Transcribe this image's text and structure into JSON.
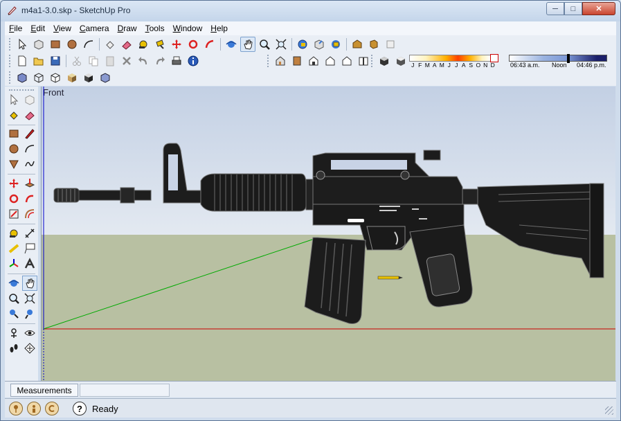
{
  "window": {
    "title": "m4a1-3.0.skp - SketchUp Pro",
    "buttons": {
      "minimize": "─",
      "maximize": "□",
      "close": "✕"
    }
  },
  "menu": [
    "File",
    "Edit",
    "View",
    "Camera",
    "Draw",
    "Tools",
    "Window",
    "Help"
  ],
  "viewport": {
    "scene_label": "Front"
  },
  "shadow_settings": {
    "months": [
      "J",
      "F",
      "M",
      "A",
      "M",
      "J",
      "J",
      "A",
      "S",
      "O",
      "N",
      "D"
    ],
    "time_start": "06:43 a.m.",
    "time_mid": "Noon",
    "time_end": "04:46 p.m."
  },
  "measurements": {
    "label": "Measurements",
    "value": ""
  },
  "status": {
    "text": "Ready",
    "help_icon": "?"
  },
  "colors": {
    "sky_top": "#c3d0e4",
    "ground": "#b8c0a2",
    "x_axis": "#cc0000",
    "y_axis": "#00aa00",
    "z_axis": "#0000cc"
  }
}
